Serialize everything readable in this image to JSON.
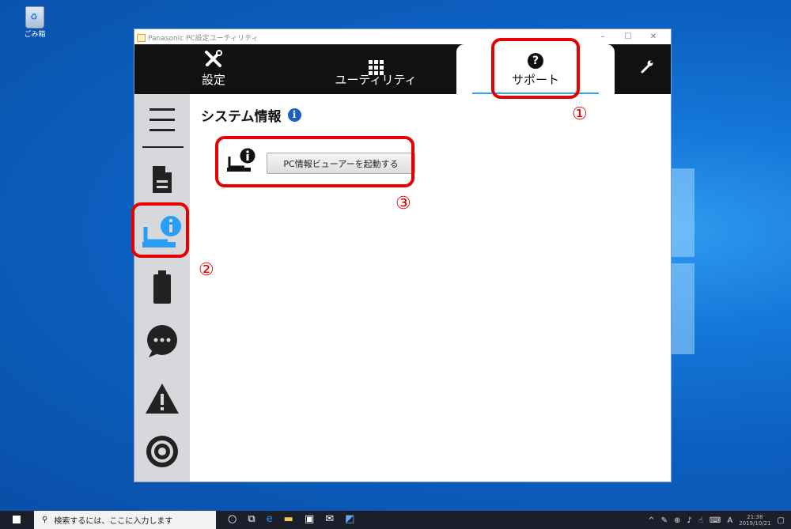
{
  "desktop": {
    "recycle_label": "ごみ箱"
  },
  "window": {
    "title": "Panasonic PC設定ユーティリティ",
    "controls": [
      "–",
      "☐",
      "✕"
    ]
  },
  "tabs": [
    {
      "label": "設定",
      "icon": "tools-icon"
    },
    {
      "label": "ユーティリティ",
      "icon": "grid-icon"
    },
    {
      "label": "サポート",
      "icon": "question-icon",
      "active": true
    }
  ],
  "settings_icon": "wrench-icon",
  "sidebar": {
    "items": [
      "menu-icon",
      "document-icon",
      "pc-info-icon",
      "battery-icon",
      "chat-icon",
      "warning-icon",
      "target-icon"
    ],
    "selected": "pc-info-icon"
  },
  "content": {
    "heading": "システム情報",
    "launch_button": "PC情報ビューアーを起動する"
  },
  "annotations": [
    "①",
    "②",
    "③"
  ],
  "taskbar": {
    "search_placeholder": "検索するには、ここに入力します",
    "ime": "A",
    "clock_time": "21:38",
    "clock_date": "2019/10/21"
  },
  "colors": {
    "highlight": "#e60000",
    "accent": "#2aa7e8",
    "info": "#1e5fbf",
    "selected_icon": "#2a9df4"
  }
}
